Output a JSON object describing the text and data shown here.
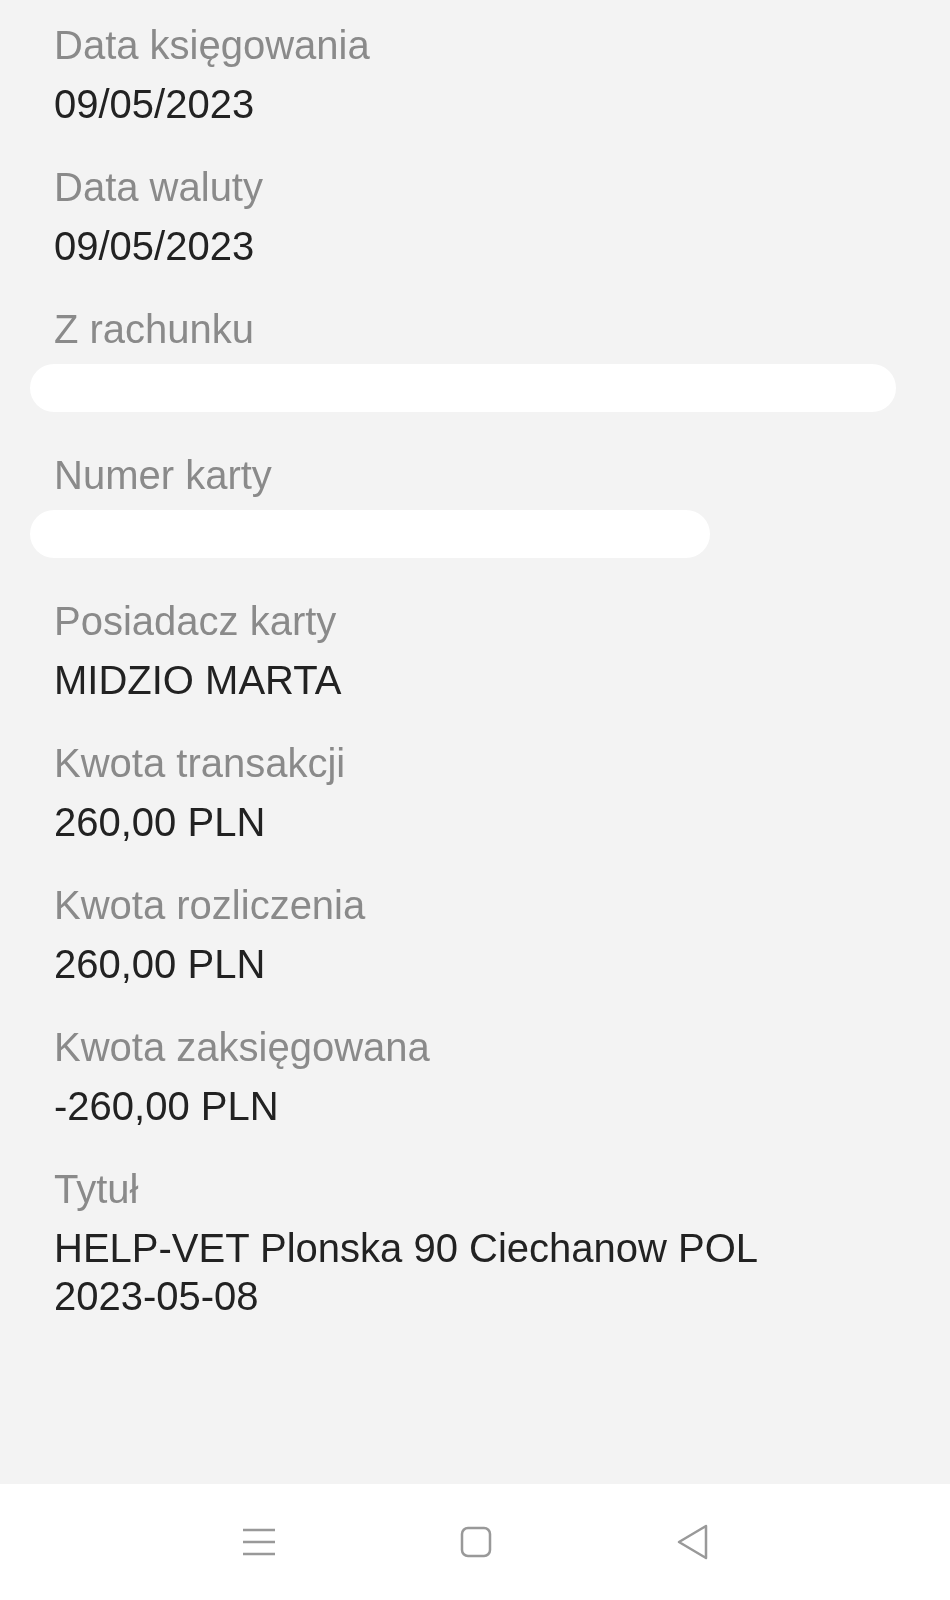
{
  "fields": [
    {
      "label": "Data księgowania",
      "kind": "text",
      "value": "09/05/2023"
    },
    {
      "label": "Data waluty",
      "kind": "text",
      "value": "09/05/2023"
    },
    {
      "label": "Z rachunku",
      "kind": "redacted"
    },
    {
      "label": "Numer karty",
      "kind": "redacted"
    },
    {
      "label": "Posiadacz karty",
      "kind": "text",
      "value": "MIDZIO MARTA"
    },
    {
      "label": "Kwota transakcji",
      "kind": "text",
      "value": "260,00 PLN"
    },
    {
      "label": "Kwota rozliczenia",
      "kind": "text",
      "value": "260,00 PLN"
    },
    {
      "label": "Kwota zaksięgowana",
      "kind": "text",
      "value": "-260,00 PLN"
    },
    {
      "label": "Tytuł",
      "kind": "text",
      "value": "HELP-VET Plonska 90 Ciechanow POL 2023-05-08"
    }
  ]
}
